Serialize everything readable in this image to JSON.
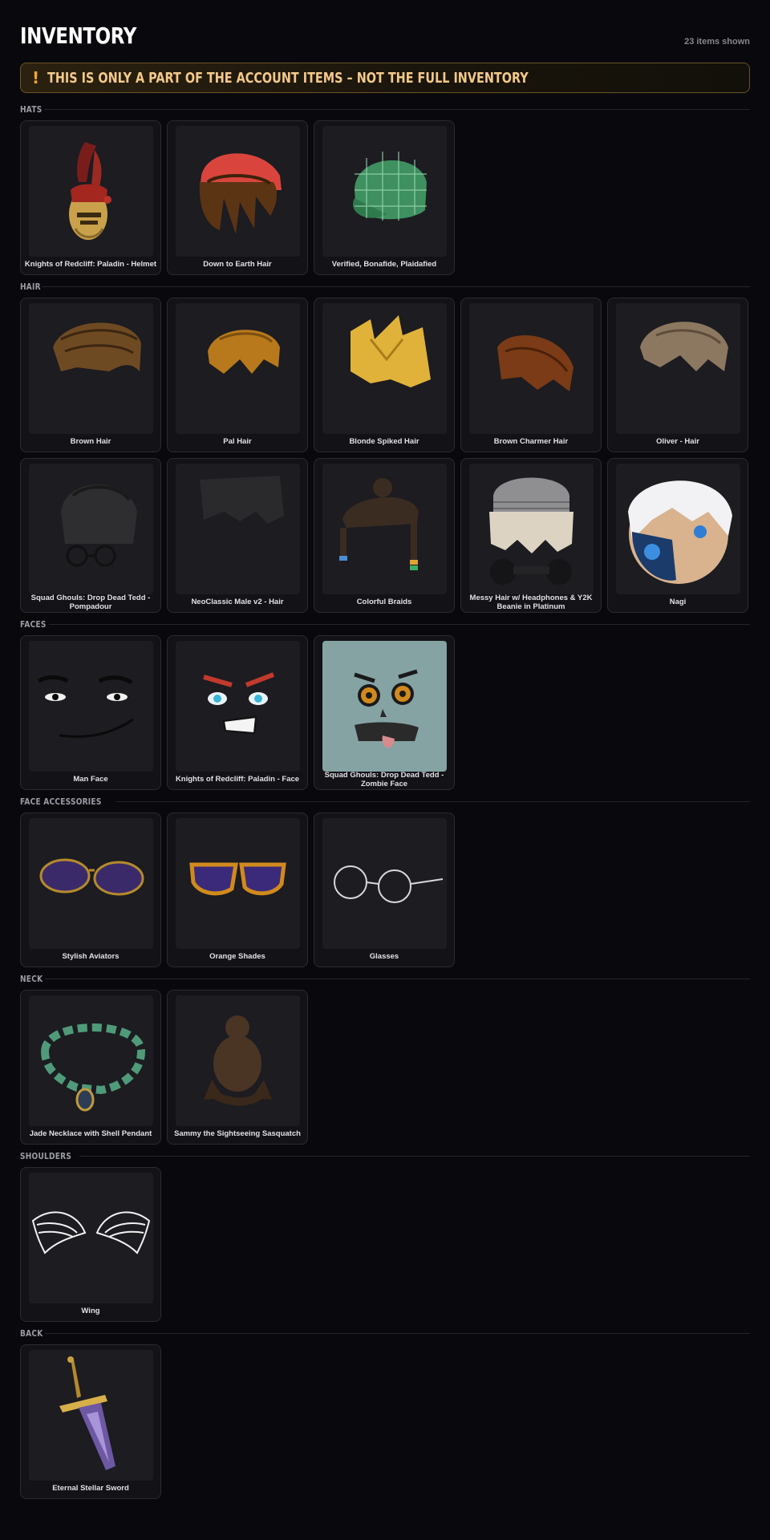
{
  "header": {
    "title": "INVENTORY",
    "count": "23 items shown"
  },
  "warning": {
    "icon": "exclamation-icon",
    "text": "THIS IS ONLY A PART OF THE ACCOUNT ITEMS – NOT THE FULL INVENTORY"
  },
  "colors": {
    "background": "#09090d",
    "card": "#121217",
    "warning_text": "#f4c98a",
    "warning_border": "#6b5327"
  },
  "sections": [
    {
      "label": "HATS",
      "items": [
        {
          "name": "Knights of Redcliff: Paladin - Helmet"
        },
        {
          "name": "Down to Earth Hair"
        },
        {
          "name": "Verified, Bonafide, Plaidafied"
        }
      ]
    },
    {
      "label": "HAIR",
      "items": [
        {
          "name": "Brown Hair"
        },
        {
          "name": "Pal Hair"
        },
        {
          "name": "Blonde Spiked Hair"
        },
        {
          "name": "Brown Charmer Hair"
        },
        {
          "name": "Oliver - Hair"
        },
        {
          "name": "Squad Ghouls: Drop Dead Tedd - Pompadour"
        },
        {
          "name": "NeoClassic Male v2 - Hair"
        },
        {
          "name": "Colorful Braids"
        },
        {
          "name": "Messy Hair w/ Headphones & Y2K Beanie in Platinum"
        },
        {
          "name": "Nagi"
        }
      ]
    },
    {
      "label": "FACES",
      "items": [
        {
          "name": "Man Face"
        },
        {
          "name": "Knights of Redcliff: Paladin - Face"
        },
        {
          "name": "Squad Ghouls: Drop Dead Tedd - Zombie Face"
        }
      ]
    },
    {
      "label": "FACE ACCESSORIES",
      "items": [
        {
          "name": "Stylish Aviators"
        },
        {
          "name": "Orange Shades"
        },
        {
          "name": "Glasses"
        }
      ]
    },
    {
      "label": "NECK",
      "items": [
        {
          "name": "Jade Necklace with Shell Pendant"
        },
        {
          "name": "Sammy the Sightseeing Sasquatch"
        }
      ]
    },
    {
      "label": "SHOULDERS",
      "items": [
        {
          "name": "Wing"
        }
      ]
    },
    {
      "label": "BACK",
      "items": [
        {
          "name": "Eternal Stellar Sword"
        }
      ]
    }
  ]
}
